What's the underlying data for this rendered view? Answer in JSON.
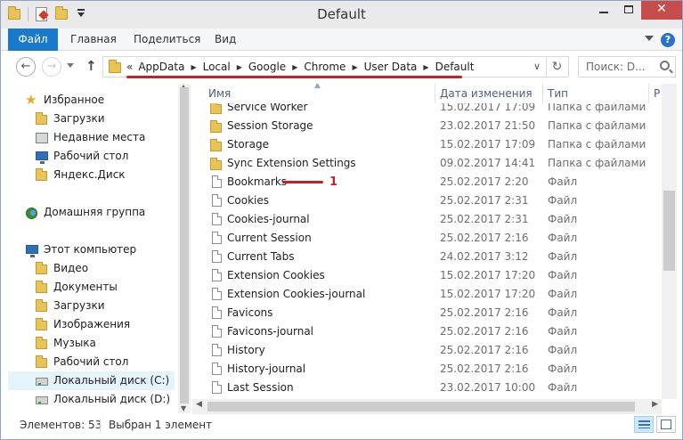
{
  "window": {
    "title": "Default"
  },
  "ribbon": {
    "tabs": [
      {
        "label": "Файл"
      },
      {
        "label": "Главная"
      },
      {
        "label": "Поделиться"
      },
      {
        "label": "Вид"
      }
    ],
    "help_label": "?"
  },
  "address": {
    "overflow": "«",
    "crumbs": [
      "AppData",
      "Local",
      "Google",
      "Chrome",
      "User Data",
      "Default"
    ]
  },
  "search": {
    "placeholder": "Поиск: D..."
  },
  "navigation": {
    "favorites_label": "Избранное",
    "favorites": [
      "Загрузки",
      "Недавние места",
      "Рабочий стол",
      "Яндекс.Диск"
    ],
    "homegroup_label": "Домашняя группа",
    "computer_label": "Этот компьютер",
    "computer_items": [
      "Видео",
      "Документы",
      "Загрузки",
      "Изображения",
      "Музыка",
      "Рабочий стол",
      "Локальный диск (C:)",
      "Локальный диск (D:)"
    ],
    "selected_item": "Локальный диск (C:)"
  },
  "columns": {
    "name": "Имя",
    "date": "Дата изменения",
    "type": "Тип",
    "extra": "Р"
  },
  "files": [
    {
      "name": "Service Worker",
      "date": "15.02.2017 17:09",
      "type": "Папка с файлами",
      "kind": "folder"
    },
    {
      "name": "Session Storage",
      "date": "23.02.2017 21:50",
      "type": "Папка с файлами",
      "kind": "folder"
    },
    {
      "name": "Storage",
      "date": "15.02.2017 17:09",
      "type": "Папка с файлами",
      "kind": "folder"
    },
    {
      "name": "Sync Extension Settings",
      "date": "09.02.2017 14:41",
      "type": "Папка с файлами",
      "kind": "folder"
    },
    {
      "name": "Bookmarks",
      "date": "25.02.2017 2:20",
      "type": "Файл",
      "kind": "file",
      "annotation": "1"
    },
    {
      "name": "Cookies",
      "date": "25.02.2017 2:31",
      "type": "Файл",
      "kind": "file"
    },
    {
      "name": "Cookies-journal",
      "date": "25.02.2017 2:31",
      "type": "Файл",
      "kind": "file"
    },
    {
      "name": "Current Session",
      "date": "25.02.2017 2:16",
      "type": "Файл",
      "kind": "file"
    },
    {
      "name": "Current Tabs",
      "date": "24.02.2017 3:12",
      "type": "Файл",
      "kind": "file"
    },
    {
      "name": "Extension Cookies",
      "date": "15.02.2017 17:20",
      "type": "Файл",
      "kind": "file"
    },
    {
      "name": "Extension Cookies-journal",
      "date": "15.02.2017 17:20",
      "type": "Файл",
      "kind": "file"
    },
    {
      "name": "Favicons",
      "date": "25.02.2017 2:16",
      "type": "Файл",
      "kind": "file"
    },
    {
      "name": "Favicons-journal",
      "date": "25.02.2017 2:16",
      "type": "Файл",
      "kind": "file"
    },
    {
      "name": "History",
      "date": "25.02.2017 2:16",
      "type": "Файл",
      "kind": "file"
    },
    {
      "name": "History-journal",
      "date": "25.02.2017 2:16",
      "type": "Файл",
      "kind": "file"
    },
    {
      "name": "Last Session",
      "date": "23.02.2017 10:00",
      "type": "Файл",
      "kind": "file"
    }
  ],
  "status": {
    "items_count": "Элементов: 53",
    "selected": "Выбран 1 элемент"
  },
  "colors": {
    "accent": "#1979ca",
    "annotation": "#c0222b",
    "close": "#c74c4c"
  },
  "icons": {
    "folder": "folder-icon",
    "file": "file-icon",
    "favorites": "star-icon"
  }
}
